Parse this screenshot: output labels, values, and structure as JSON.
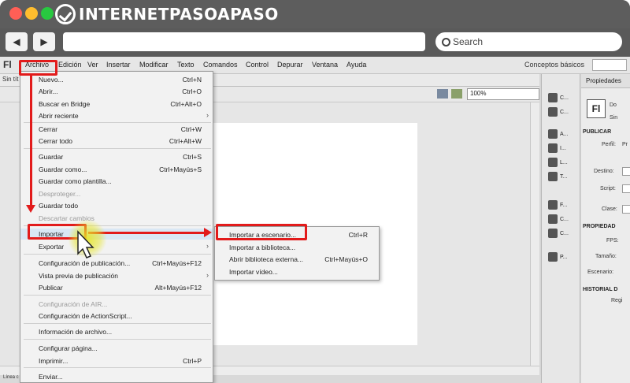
{
  "browser": {
    "logo_text": "INTERNETPASOAPASO",
    "search_label": "Search"
  },
  "app": {
    "logo": "Fl",
    "menus": [
      "Archivo",
      "Edición",
      "Ver",
      "Insertar",
      "Modificar",
      "Texto",
      "Comandos",
      "Control",
      "Depurar",
      "Ventana",
      "Ayuda"
    ],
    "workspace": "Conceptos básicos",
    "doc_tab": "Sin tít",
    "zoom": "100%",
    "status": "Línea c"
  },
  "file_menu": [
    {
      "label": "Nuevo...",
      "shortcut": "Ctrl+N"
    },
    {
      "label": "Abrir...",
      "shortcut": "Ctrl+O"
    },
    {
      "label": "Buscar en Bridge",
      "shortcut": "Ctrl+Alt+O"
    },
    {
      "label": "Abrir reciente",
      "shortcut": ""
    },
    {
      "label": "Cerrar",
      "shortcut": "Ctrl+W"
    },
    {
      "label": "Cerrar todo",
      "shortcut": "Ctrl+Alt+W"
    },
    {
      "label": "Guardar",
      "shortcut": "Ctrl+S"
    },
    {
      "label": "Guardar como...",
      "shortcut": "Ctrl+Mayús+S"
    },
    {
      "label": "Guardar como plantilla...",
      "shortcut": ""
    },
    {
      "label": "Desproteger...",
      "shortcut": ""
    },
    {
      "label": "Guardar todo",
      "shortcut": ""
    },
    {
      "label": "Descartar cambios",
      "shortcut": ""
    },
    {
      "label": "Importar",
      "shortcut": ""
    },
    {
      "label": "Exportar",
      "shortcut": ""
    },
    {
      "label": "Configuración de publicación...",
      "shortcut": "Ctrl+Mayús+F12"
    },
    {
      "label": "Vista previa de publicación",
      "shortcut": ""
    },
    {
      "label": "Publicar",
      "shortcut": "Alt+Mayús+F12"
    },
    {
      "label": "Configuración de AIR...",
      "shortcut": ""
    },
    {
      "label": "Configuración de ActionScript...",
      "shortcut": ""
    },
    {
      "label": "Información de archivo...",
      "shortcut": ""
    },
    {
      "label": "Configurar página...",
      "shortcut": ""
    },
    {
      "label": "Imprimir...",
      "shortcut": "Ctrl+P"
    },
    {
      "label": "Enviar...",
      "shortcut": ""
    }
  ],
  "import_submenu": [
    {
      "label": "Importar a escenario...",
      "shortcut": "Ctrl+R"
    },
    {
      "label": "Importar a biblioteca...",
      "shortcut": ""
    },
    {
      "label": "Abrir biblioteca externa...",
      "shortcut": "Ctrl+Mayús+O"
    },
    {
      "label": "Importar vídeo...",
      "shortcut": ""
    }
  ],
  "tools_panel": [
    "C...",
    "C...",
    "A...",
    "I...",
    "L...",
    "T...",
    "F...",
    "C...",
    "C...",
    "P..."
  ],
  "properties": {
    "tab": "Propiedades",
    "tab2": "Bi",
    "doc_label": "Do",
    "sin_label": "Sin",
    "publish_section": "PUBLICAR",
    "profile_label": "Perfil:",
    "profile_value": "Pr",
    "target_label": "Destino:",
    "target_value": "F",
    "script_label": "Script:",
    "script_value": "A",
    "class_label": "Clase:",
    "props_section": "PROPIEDAD",
    "fps_label": "FPS:",
    "size_label": "Tamaño:",
    "stage_label": "Escenario:",
    "history_section": "HISTORIAL D",
    "history_button": "Regi"
  }
}
